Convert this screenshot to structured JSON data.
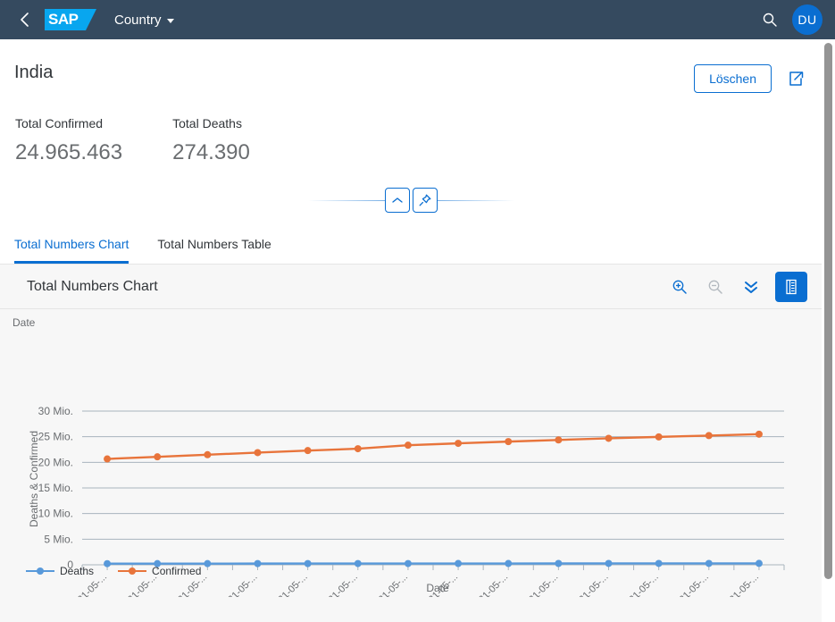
{
  "shellbar": {
    "back_icon": "chevron-left-icon",
    "logo_text": "SAP",
    "app_title": "Country",
    "search_icon": "search-icon",
    "avatar_initials": "DU"
  },
  "object_header": {
    "title": "India",
    "delete_label": "Löschen",
    "share_icon": "share-icon",
    "kpis": [
      {
        "label": "Total Confirmed",
        "value": "24.965.463"
      },
      {
        "label": "Total Deaths",
        "value": "274.390"
      }
    ],
    "collapse_icon": "chevron-up-icon",
    "pin_icon": "pin-icon"
  },
  "tabs": [
    {
      "label": "Total Numbers Chart",
      "active": true
    },
    {
      "label": "Total Numbers Table",
      "active": false
    }
  ],
  "chart_card": {
    "title": "Total Numbers Chart",
    "tools": [
      {
        "name": "zoom-in-icon",
        "enabled": true
      },
      {
        "name": "zoom-out-icon",
        "enabled": false
      },
      {
        "name": "chevron-double-down-icon",
        "enabled": true
      },
      {
        "name": "legend-table-toggle-icon",
        "enabled": true,
        "selected": true
      }
    ]
  },
  "colors": {
    "shell_bg": "#354a5f",
    "accent": "#0a6ed1",
    "sap_blue": "#08a6ef",
    "deaths": "#5899da",
    "confirmed": "#e8743b",
    "text": "#32363a",
    "muted": "#6a6d70",
    "grid": "#a9b4be",
    "card_bg": "#f7f7f7"
  },
  "chart_data": {
    "type": "line",
    "title": "Total Numbers Chart",
    "xlabel": "Date",
    "ylabel": "Deaths & Confirmed",
    "top_axis_label": "Date",
    "grid": true,
    "legend_position": "bottom-left",
    "ylim": [
      0,
      30000000
    ],
    "yticks": [
      0,
      5000000,
      10000000,
      15000000,
      20000000,
      25000000,
      30000000
    ],
    "ytick_labels": [
      "0",
      "5 Mio.",
      "10 Mio.",
      "15 Mio.",
      "20 Mio.",
      "25 Mio.",
      "30 Mio."
    ],
    "categories": [
      "2021-05-...",
      "2021-05-...",
      "2021-05-...",
      "2021-05-...",
      "2021-05-...",
      "2021-05-...",
      "2021-05-...",
      "2021-05-...",
      "2021-05-...",
      "2021-05-...",
      "2021-05-...",
      "2021-05-...",
      "2021-05-...",
      "2021-05-..."
    ],
    "series": [
      {
        "name": "Deaths",
        "color": "#5899da",
        "values": [
          226188,
          230168,
          234083,
          238270,
          242362,
          246116,
          250025,
          254197,
          258317,
          262317,
          266207,
          270284,
          272312,
          274390
        ]
      },
      {
        "name": "Confirmed",
        "color": "#e8743b",
        "values": [
          20665148,
          21077410,
          21491598,
          21892676,
          22296414,
          22662575,
          23340938,
          23703665,
          24046809,
          24372907,
          24684077,
          24965463,
          25222819,
          25495144
        ]
      }
    ]
  }
}
